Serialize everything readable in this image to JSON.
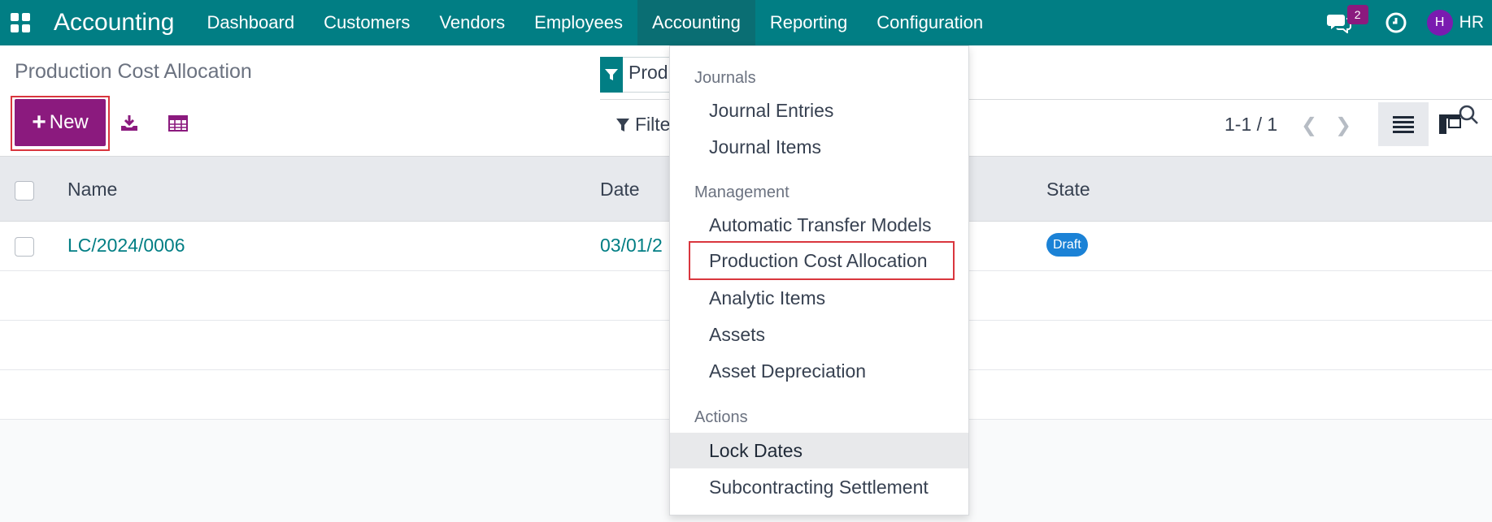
{
  "navbar": {
    "brand": "Accounting",
    "menu": [
      "Dashboard",
      "Customers",
      "Vendors",
      "Employees",
      "Accounting",
      "Reporting",
      "Configuration"
    ],
    "chat_count": "2",
    "avatar_initial": "H",
    "user_initials": "HR",
    "color": "#017e84"
  },
  "control": {
    "page_title": "Production Cost Allocation",
    "new_label": "New",
    "search_facet": "Prod",
    "filter_label": "Filte",
    "pager": "1-1 / 1"
  },
  "table": {
    "headers": [
      "Name",
      "Date",
      "State"
    ],
    "rows": [
      {
        "name": "LC/2024/0006",
        "date": "03/01/2",
        "state": "Draft"
      }
    ]
  },
  "dropdown": {
    "sections": [
      {
        "title": "Journals",
        "items": [
          "Journal Entries",
          "Journal Items"
        ]
      },
      {
        "title": "Management",
        "items": [
          "Automatic Transfer Models",
          "Production Cost Allocation",
          "Analytic Items",
          "Assets",
          "Asset Depreciation"
        ]
      },
      {
        "title": "Actions",
        "items": [
          "Lock Dates",
          "Subcontracting Settlement"
        ]
      }
    ]
  },
  "colors": {
    "brand_purple": "#8b1a7e",
    "highlight_red": "#d9363e",
    "draft_blue": "#1b82d6"
  }
}
